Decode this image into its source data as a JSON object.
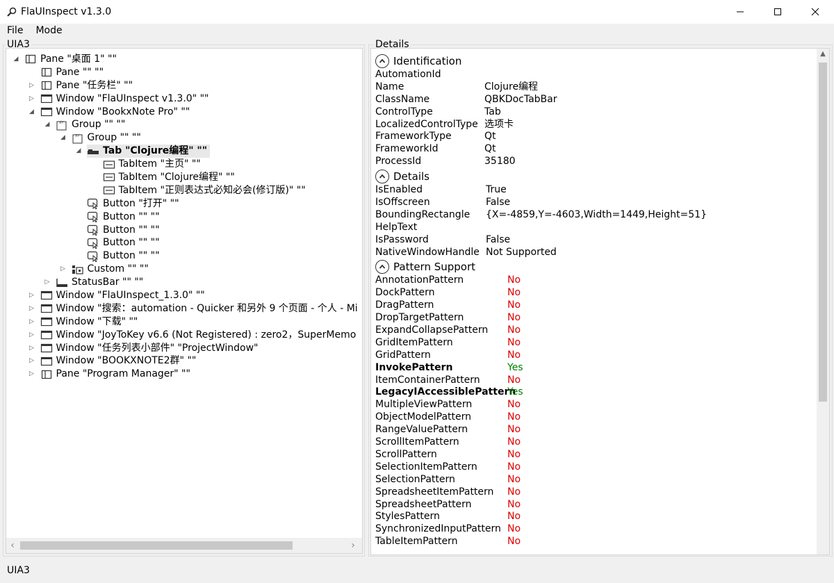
{
  "window": {
    "title": "FlaUInspect v1.3.0",
    "icon": "magnifier-icon"
  },
  "menu": {
    "file": "File",
    "mode": "Mode"
  },
  "left_group": {
    "label": "UIA3"
  },
  "right_group": {
    "label": "Details"
  },
  "tree": [
    {
      "depth": 0,
      "exp": "open",
      "icon": "pane-icon",
      "label": "Pane \"桌面 1\" \"\""
    },
    {
      "depth": 1,
      "exp": "none",
      "icon": "pane-icon",
      "label": "Pane \"\" \"\""
    },
    {
      "depth": 1,
      "exp": "closed",
      "icon": "pane-icon",
      "label": "Pane \"任务栏\" \"\""
    },
    {
      "depth": 1,
      "exp": "closed",
      "icon": "window-icon",
      "label": "Window \"FlaUInspect v1.3.0\" \"\""
    },
    {
      "depth": 1,
      "exp": "open",
      "icon": "window-icon",
      "label": "Window \"BookxNote Pro\" \"\""
    },
    {
      "depth": 2,
      "exp": "open",
      "icon": "group-icon",
      "label": "Group \"\" \"\""
    },
    {
      "depth": 3,
      "exp": "open",
      "icon": "group-icon",
      "label": "Group \"\" \"\""
    },
    {
      "depth": 4,
      "exp": "open",
      "icon": "tab-icon",
      "label": "Tab \"Clojure编程\" \"\"",
      "bold": true,
      "selected": true
    },
    {
      "depth": 5,
      "exp": "none",
      "icon": "tabitem-icon",
      "label": "TabItem \"主页\" \"\""
    },
    {
      "depth": 5,
      "exp": "none",
      "icon": "tabitem-icon",
      "label": "TabItem \"Clojure编程\" \"\""
    },
    {
      "depth": 5,
      "exp": "none",
      "icon": "tabitem-icon",
      "label": "TabItem \"正则表达式必知必会(修订版)\" \"\""
    },
    {
      "depth": 4,
      "exp": "none",
      "icon": "button-icon",
      "label": "Button \"打开\" \"\""
    },
    {
      "depth": 4,
      "exp": "none",
      "icon": "button-icon",
      "label": "Button \"\" \"\""
    },
    {
      "depth": 4,
      "exp": "none",
      "icon": "button-icon",
      "label": "Button \"\" \"\""
    },
    {
      "depth": 4,
      "exp": "none",
      "icon": "button-icon",
      "label": "Button \"\" \"\""
    },
    {
      "depth": 4,
      "exp": "none",
      "icon": "button-icon",
      "label": "Button \"\" \"\""
    },
    {
      "depth": 3,
      "exp": "closed",
      "icon": "custom-icon",
      "label": "Custom \"\" \"\""
    },
    {
      "depth": 2,
      "exp": "closed",
      "icon": "statusbar-icon",
      "label": "StatusBar \"\" \"\""
    },
    {
      "depth": 1,
      "exp": "closed",
      "icon": "window-icon",
      "label": "Window \"FlaUInspect_1.3.0\" \"\""
    },
    {
      "depth": 1,
      "exp": "closed",
      "icon": "window-icon",
      "label": "Window \"搜索：automation - Quicker 和另外 9 个页面 - 个人 - Mi"
    },
    {
      "depth": 1,
      "exp": "closed",
      "icon": "window-icon",
      "label": "Window \"下载\" \"\""
    },
    {
      "depth": 1,
      "exp": "closed",
      "icon": "window-icon",
      "label": "Window \"JoyToKey v6.6 (Not Registered) : zero2，SuperMemo"
    },
    {
      "depth": 1,
      "exp": "closed",
      "icon": "window-icon",
      "label": "Window \"任务列表小部件\" \"ProjectWindow\""
    },
    {
      "depth": 1,
      "exp": "closed",
      "icon": "window-icon",
      "label": "Window \"BOOKXNOTE2群\" \"\""
    },
    {
      "depth": 1,
      "exp": "closed",
      "icon": "pane-icon",
      "label": "Pane \"Program Manager\" \"\""
    }
  ],
  "identification": {
    "title": "Identification",
    "rows": [
      {
        "k": "AutomationId",
        "v": ""
      },
      {
        "k": "Name",
        "v": "Clojure编程"
      },
      {
        "k": "ClassName",
        "v": "QBKDocTabBar"
      },
      {
        "k": "ControlType",
        "v": "Tab"
      },
      {
        "k": "LocalizedControlType",
        "v": "选项卡"
      },
      {
        "k": "FrameworkType",
        "v": "Qt"
      },
      {
        "k": "FrameworkId",
        "v": "Qt"
      },
      {
        "k": "ProcessId",
        "v": "35180"
      }
    ]
  },
  "details": {
    "title": "Details",
    "rows": [
      {
        "k": "IsEnabled",
        "v": "True"
      },
      {
        "k": "IsOffscreen",
        "v": "False"
      },
      {
        "k": "BoundingRectangle",
        "v": "{X=-4859,Y=-4603,Width=1449,Height=51}"
      },
      {
        "k": "HelpText",
        "v": ""
      },
      {
        "k": "IsPassword",
        "v": "False"
      },
      {
        "k": "NativeWindowHandle",
        "v": "Not Supported"
      }
    ]
  },
  "patterns": {
    "title": "Pattern Support",
    "rows": [
      {
        "k": "AnnotationPattern",
        "v": "No"
      },
      {
        "k": "DockPattern",
        "v": "No"
      },
      {
        "k": "DragPattern",
        "v": "No"
      },
      {
        "k": "DropTargetPattern",
        "v": "No"
      },
      {
        "k": "ExpandCollapsePattern",
        "v": "No"
      },
      {
        "k": "GridItemPattern",
        "v": "No"
      },
      {
        "k": "GridPattern",
        "v": "No"
      },
      {
        "k": "InvokePattern",
        "v": "Yes",
        "bold": true
      },
      {
        "k": "ItemContainerPattern",
        "v": "No"
      },
      {
        "k": "LegacyIAccessiblePattern",
        "v": "Yes",
        "bold": true
      },
      {
        "k": "MultipleViewPattern",
        "v": "No"
      },
      {
        "k": "ObjectModelPattern",
        "v": "No"
      },
      {
        "k": "RangeValuePattern",
        "v": "No"
      },
      {
        "k": "ScrollItemPattern",
        "v": "No"
      },
      {
        "k": "ScrollPattern",
        "v": "No"
      },
      {
        "k": "SelectionItemPattern",
        "v": "No"
      },
      {
        "k": "SelectionPattern",
        "v": "No"
      },
      {
        "k": "SpreadsheetItemPattern",
        "v": "No"
      },
      {
        "k": "SpreadsheetPattern",
        "v": "No"
      },
      {
        "k": "StylesPattern",
        "v": "No"
      },
      {
        "k": "SynchronizedInputPattern",
        "v": "No"
      },
      {
        "k": "TableItemPattern",
        "v": "No"
      }
    ]
  },
  "status": {
    "text": "UIA3"
  },
  "colors": {
    "no": "#e00000",
    "yes": "#008000"
  }
}
